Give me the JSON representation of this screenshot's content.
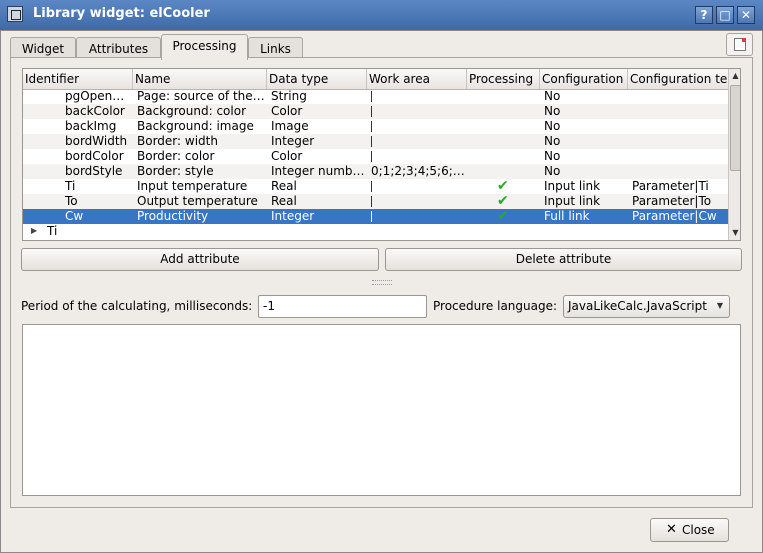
{
  "window": {
    "title": "Library widget: elCooler",
    "btn_help": "?",
    "btn_max": "□",
    "btn_close": "✕"
  },
  "tabs": [
    {
      "label": "Widget"
    },
    {
      "label": "Attributes"
    },
    {
      "label": "Processing",
      "active": true
    },
    {
      "label": "Links"
    }
  ],
  "table": {
    "headers": [
      "Identifier",
      "Name",
      "Data type",
      "Work area",
      "Processing",
      "Configuration",
      "Configuration te"
    ],
    "rows": [
      {
        "id": "pgOpen…",
        "name": "Page: source of the…",
        "type": "String",
        "work": "",
        "proc": false,
        "config": "No",
        "conftext": ""
      },
      {
        "id": "backColor",
        "name": "Background: color",
        "type": "Color",
        "work": "",
        "proc": false,
        "config": "No",
        "conftext": ""
      },
      {
        "id": "backImg",
        "name": "Background: image",
        "type": "Image",
        "work": "",
        "proc": false,
        "config": "No",
        "conftext": ""
      },
      {
        "id": "bordWidth",
        "name": "Border: width",
        "type": "Integer",
        "work": "",
        "proc": false,
        "config": "No",
        "conftext": ""
      },
      {
        "id": "bordColor",
        "name": "Border: color",
        "type": "Color",
        "work": "",
        "proc": false,
        "config": "No",
        "conftext": ""
      },
      {
        "id": "bordStyle",
        "name": "Border: style",
        "type": "Integer numb…",
        "work": "0;1;2;3;4;5;6;…",
        "proc": false,
        "config": "No",
        "conftext": ""
      },
      {
        "id": "Ti",
        "name": "Input temperature",
        "type": "Real",
        "work": "",
        "proc": true,
        "config": "Input link",
        "conftext": "Parameter|Ti"
      },
      {
        "id": "To",
        "name": "Output temperature",
        "type": "Real",
        "work": "",
        "proc": true,
        "config": "Input link",
        "conftext": "Parameter|To"
      },
      {
        "id": "Cw",
        "name": "Productivity",
        "type": "Integer",
        "work": "",
        "proc": true,
        "config": "Full link",
        "conftext": "Parameter|Cw",
        "selected": true
      }
    ],
    "tree_item": "Ti"
  },
  "buttons": {
    "add": "Add attribute",
    "delete": "Delete attribute",
    "close": "Close"
  },
  "period": {
    "label": "Period of the calculating, milliseconds:",
    "value": "-1"
  },
  "language": {
    "label": "Procedure language:",
    "value": "JavaLikeCalc.JavaScript"
  },
  "icons": {
    "check": "check-icon",
    "close": "close-icon",
    "doc": "document-icon"
  },
  "colors": {
    "selection": "#3875c4",
    "titlebar": "#4a78b8",
    "check": "#2aa82a"
  }
}
